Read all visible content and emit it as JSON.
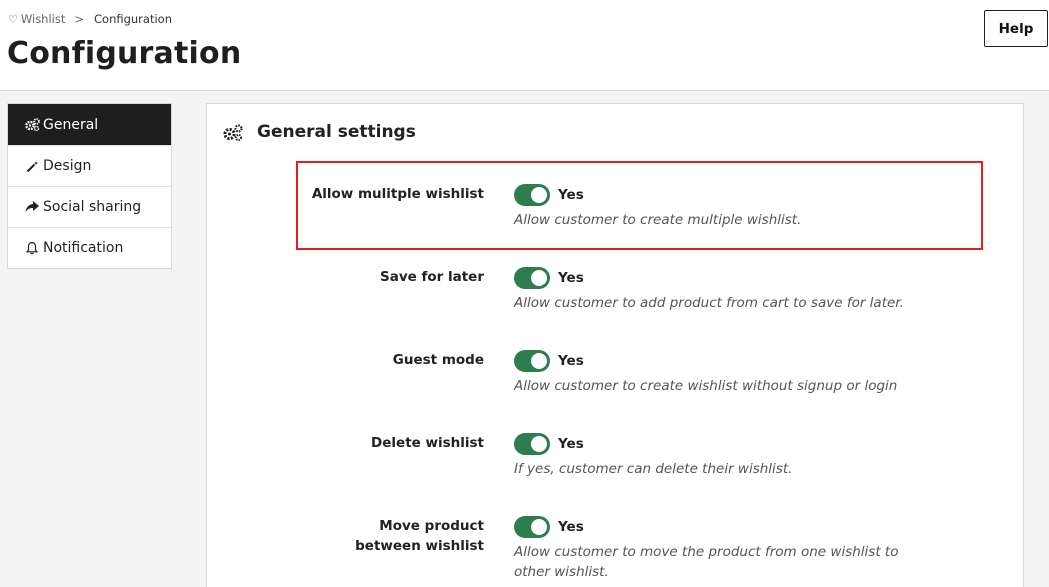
{
  "breadcrumb": {
    "wishlist": "Wishlist",
    "separator": ">",
    "current": "Configuration"
  },
  "page_title": "Configuration",
  "help_label": "Help",
  "sidebar": {
    "items": [
      {
        "label": "General",
        "icon": "gears-icon",
        "active": true
      },
      {
        "label": "Design",
        "icon": "magic-wand-icon",
        "active": false
      },
      {
        "label": "Social sharing",
        "icon": "share-icon",
        "active": false
      },
      {
        "label": "Notification",
        "icon": "bell-icon",
        "active": false
      }
    ]
  },
  "panel": {
    "title": "General settings",
    "settings": [
      {
        "label": "Allow mulitple wishlist",
        "value": "Yes",
        "help": "Allow customer to create multiple wishlist.",
        "highlighted": true
      },
      {
        "label": "Save for later",
        "value": "Yes",
        "help": "Allow customer to add product from cart to save for later."
      },
      {
        "label": "Guest mode",
        "value": "Yes",
        "help": "Allow customer to create wishlist without signup or login"
      },
      {
        "label": "Delete wishlist",
        "value": "Yes",
        "help": "If yes, customer can delete their wishlist."
      },
      {
        "label": "Move product between wishlist",
        "value": "Yes",
        "help": "Allow customer to move the product from one wishlist to other wishlist."
      }
    ]
  },
  "colors": {
    "toggle_on": "#2e7d4f",
    "active_nav": "#1e1e1e",
    "highlight_border": "#e02020"
  }
}
